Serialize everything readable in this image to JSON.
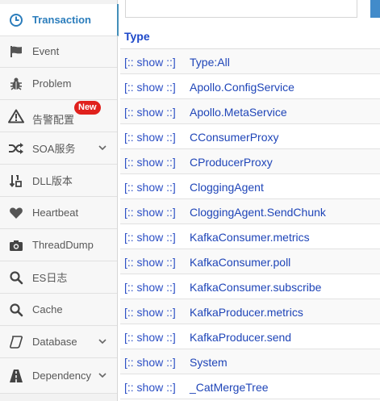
{
  "sidebar": {
    "items": [
      {
        "label": "Transaction",
        "icon": "clock-icon",
        "active": true
      },
      {
        "label": "Event",
        "icon": "flag-icon"
      },
      {
        "label": "Problem",
        "icon": "bug-icon"
      },
      {
        "label": "告警配置",
        "icon": "warning-icon",
        "badge": "New"
      },
      {
        "label": "SOA服务",
        "icon": "shuffle-icon",
        "expandable": true
      },
      {
        "label": "DLL版本",
        "icon": "sort-numeric-icon"
      },
      {
        "label": "Heartbeat",
        "icon": "heart-icon"
      },
      {
        "label": "ThreadDump",
        "icon": "camera-icon"
      },
      {
        "label": "ES日志",
        "icon": "search-icon"
      },
      {
        "label": "Cache",
        "icon": "search-icon"
      },
      {
        "label": "Database",
        "icon": "database-icon",
        "expandable": true
      },
      {
        "label": "Dependency",
        "icon": "road-icon",
        "expandable": true
      }
    ]
  },
  "table": {
    "header": "Type",
    "show_label": "[:: show ::]",
    "rows": [
      "Type:All",
      "Apollo.ConfigService",
      "Apollo.MetaService",
      "CConsumerProxy",
      "CProducerProxy",
      "CloggingAgent",
      "CloggingAgent.SendChunk",
      "KafkaConsumer.metrics",
      "KafkaConsumer.poll",
      "KafkaConsumer.subscribe",
      "KafkaProducer.metrics",
      "KafkaProducer.send",
      "System",
      "_CatMergeTree"
    ]
  },
  "colors": {
    "accent": "#438eb9",
    "link": "#1f45b8",
    "badge": "#e0211d"
  }
}
